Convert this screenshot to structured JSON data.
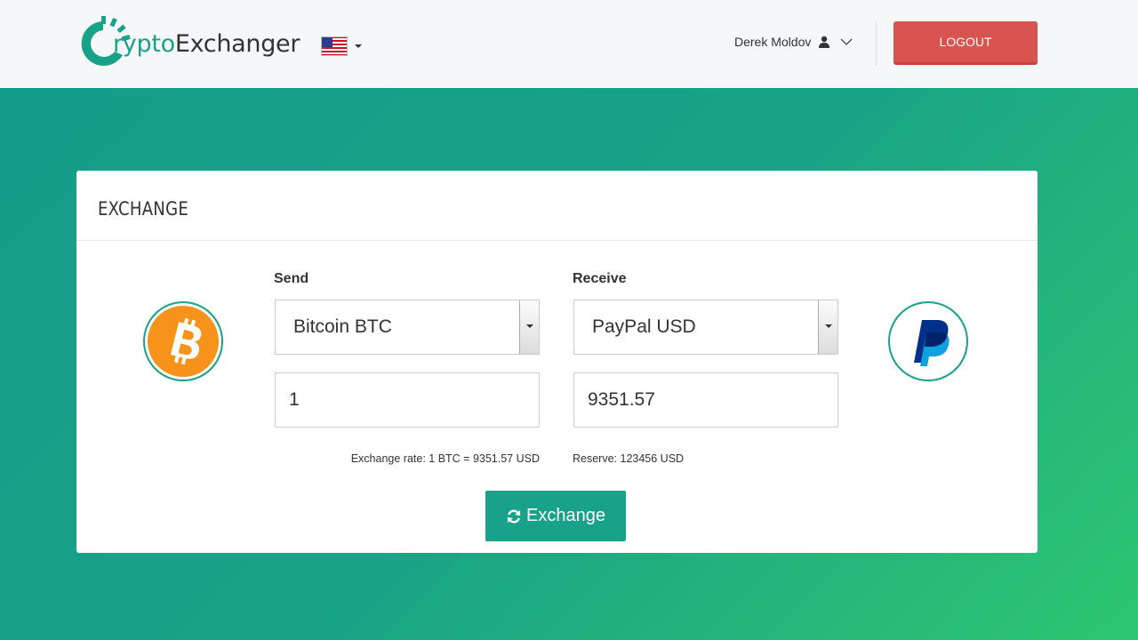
{
  "header": {
    "logo": {
      "prefix": "rypto",
      "suffix": "Exchanger",
      "brand_color": "#18a289"
    },
    "language": {
      "icon": "us-flag-icon"
    },
    "user": {
      "name": "Derek Moldov",
      "icon": "user-icon"
    },
    "logout_label": "LOGOUT"
  },
  "exchange": {
    "title": "EXCHANGE",
    "send": {
      "label": "Send",
      "currency": "Bitcoin BTC",
      "amount": "1",
      "note": "Exchange rate: 1 BTC = 9351.57 USD",
      "icon": "bitcoin-icon",
      "icon_color": "#f7931a"
    },
    "receive": {
      "label": "Receive",
      "currency": "PayPal USD",
      "amount": "9351.57",
      "note": "Reserve: 123456 USD",
      "icon": "paypal-icon",
      "icon_color": "#003087"
    },
    "button_label": "Exchange"
  },
  "colors": {
    "accent": "#18a289",
    "danger": "#d9534f",
    "gradient_end": "#2dc771"
  }
}
